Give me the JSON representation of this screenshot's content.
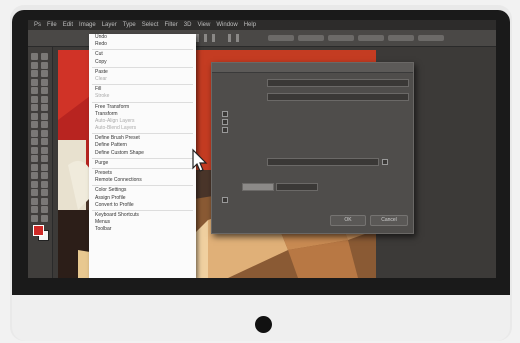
{
  "menubar": {
    "items": [
      "Ps",
      "File",
      "Edit",
      "Image",
      "Layer",
      "Type",
      "Select",
      "Filter",
      "3D",
      "View",
      "Window",
      "Help"
    ]
  },
  "edit_menu": {
    "items": [
      {
        "label": "Undo",
        "shortcut": "",
        "dim": false
      },
      {
        "label": "Redo",
        "shortcut": "",
        "dim": false
      },
      {
        "sep": true
      },
      {
        "label": "Cut",
        "shortcut": "",
        "dim": false
      },
      {
        "label": "Copy",
        "shortcut": "",
        "dim": false
      },
      {
        "sep": true
      },
      {
        "label": "Paste",
        "shortcut": "",
        "dim": false
      },
      {
        "label": "Clear",
        "shortcut": "",
        "dim": true
      },
      {
        "sep": true
      },
      {
        "label": "Fill",
        "shortcut": "",
        "dim": false
      },
      {
        "label": "Stroke",
        "shortcut": "",
        "dim": true
      },
      {
        "sep": true
      },
      {
        "label": "Free Transform",
        "shortcut": "",
        "dim": false
      },
      {
        "label": "Transform",
        "shortcut": "",
        "dim": false
      },
      {
        "label": "Auto-Align Layers",
        "shortcut": "",
        "dim": true
      },
      {
        "label": "Auto-Blend Layers",
        "shortcut": "",
        "dim": true
      },
      {
        "sep": true
      },
      {
        "label": "Define Brush Preset",
        "shortcut": "",
        "dim": false
      },
      {
        "label": "Define Pattern",
        "shortcut": "",
        "dim": false
      },
      {
        "label": "Define Custom Shape",
        "shortcut": "",
        "dim": false
      },
      {
        "sep": true
      },
      {
        "label": "Purge",
        "shortcut": "",
        "dim": false
      },
      {
        "sep": true
      },
      {
        "label": "Presets",
        "shortcut": "",
        "dim": false
      },
      {
        "label": "Remote Connections",
        "shortcut": "",
        "dim": false
      },
      {
        "sep": true
      },
      {
        "label": "Color Settings",
        "shortcut": "",
        "dim": false
      },
      {
        "label": "Assign Profile",
        "shortcut": "",
        "dim": false
      },
      {
        "label": "Convert to Profile",
        "shortcut": "",
        "dim": false
      },
      {
        "sep": true
      },
      {
        "label": "Keyboard Shortcuts",
        "shortcut": "",
        "dim": false
      },
      {
        "label": "Menus",
        "shortcut": "",
        "dim": false
      },
      {
        "label": "Toolbar",
        "shortcut": "",
        "dim": false
      }
    ]
  },
  "dialog": {
    "ok_label": "OK",
    "cancel_label": "Cancel"
  },
  "colors": {
    "foreground": "#cf2a27",
    "background": "#f5f5f5",
    "accent_orange": "#b86f2a"
  }
}
